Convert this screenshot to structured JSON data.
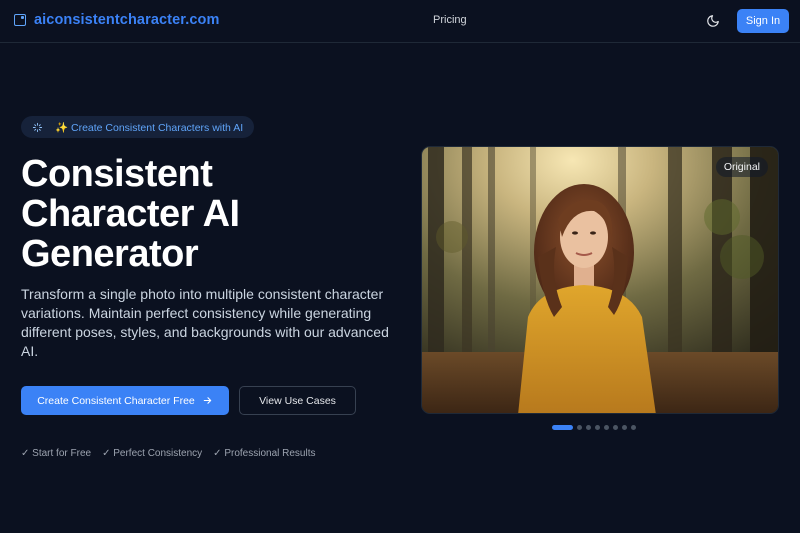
{
  "header": {
    "brand": "aiconsistentcharacter.com",
    "nav_pricing": "Pricing",
    "signin_label": "Sign In"
  },
  "hero": {
    "badge": "✨ Create Consistent Characters with AI",
    "title": "Consistent Character AI Generator",
    "description": "Transform a single photo into multiple consistent character variations. Maintain perfect consistency while generating different poses, styles, and backgrounds with our advanced AI.",
    "primary_cta": "Create Consistent Character Free",
    "secondary_cta": "View Use Cases",
    "features": [
      "✓ Start for Free",
      "✓ Perfect Consistency",
      "✓ Professional Results"
    ]
  },
  "showcase": {
    "label": "Original",
    "slide_count": 8,
    "active_slide": 1
  },
  "colors": {
    "background": "#0b1120",
    "accent": "#3b82f6",
    "brand": "#3b82f6"
  },
  "icons": {
    "brand": "brand-square-icon",
    "theme": "moon-icon",
    "badge": "sparkles-icon",
    "cta": "arrow-right-icon"
  }
}
